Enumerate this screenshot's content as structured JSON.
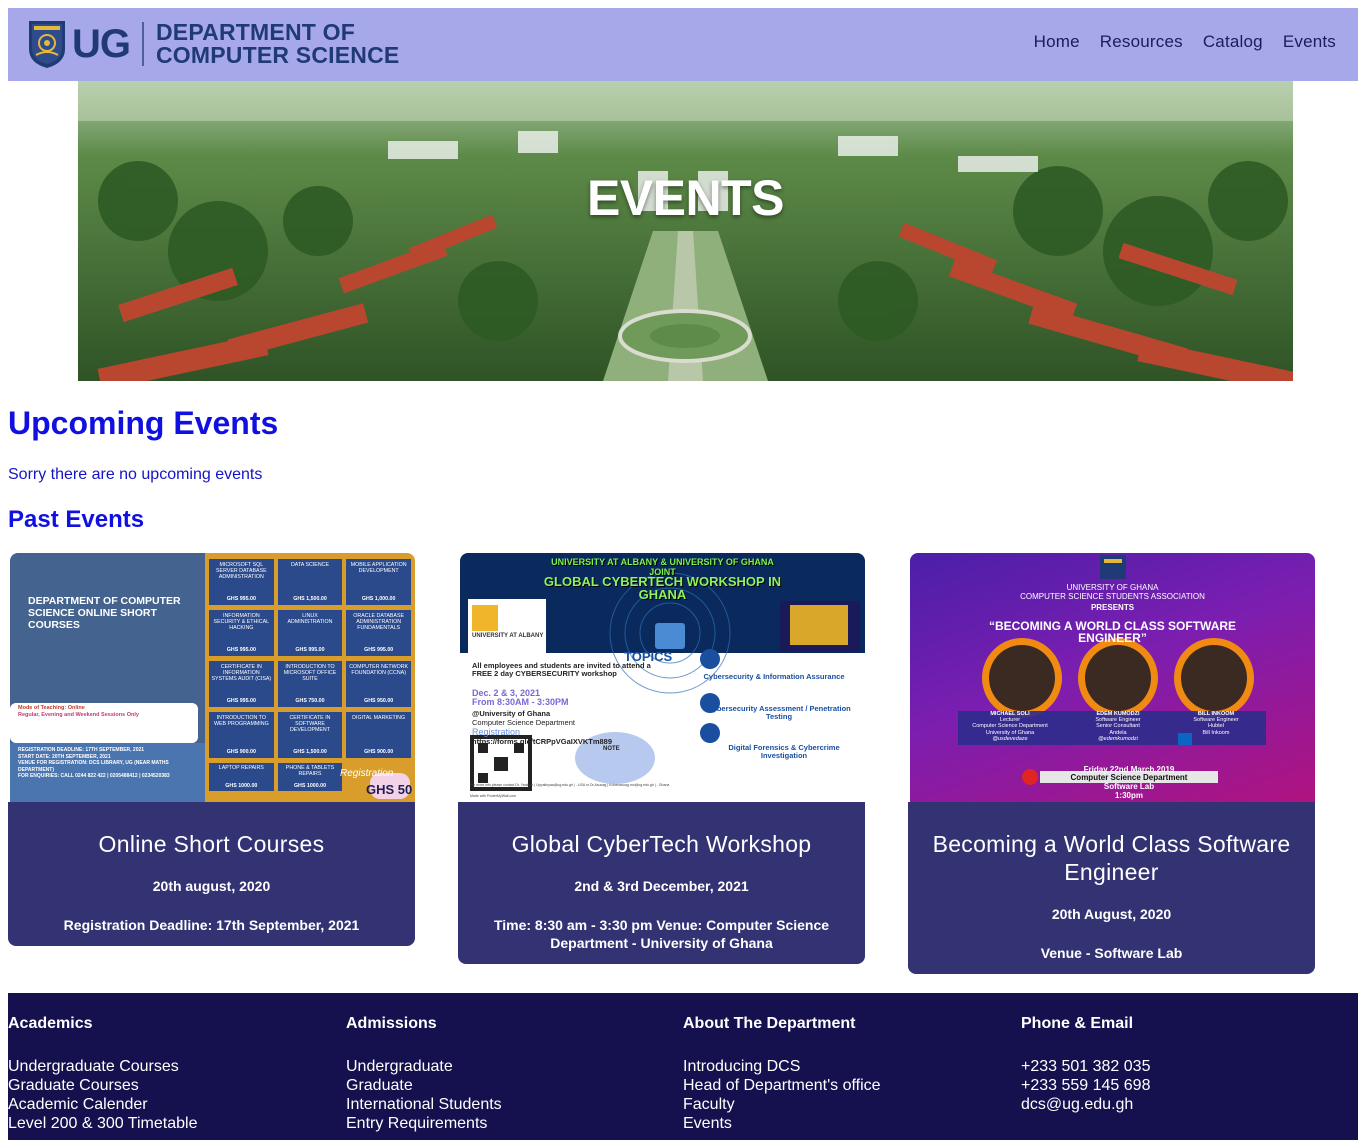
{
  "header": {
    "logo_text": "UG",
    "dept_line1": "DEPARTMENT OF",
    "dept_line2": "COMPUTER SCIENCE",
    "nav": [
      "Home",
      "Resources",
      "Catalog",
      "Events"
    ]
  },
  "hero": {
    "title": "EVENTS"
  },
  "upcoming": {
    "title": "Upcoming Events",
    "message": "Sorry there are no upcoming events"
  },
  "past": {
    "title": "Past Events",
    "events": [
      {
        "title": "Online Short Courses",
        "date": "20th august, 2020",
        "detail": "Registration Deadline: 17th September, 2021",
        "poster": {
          "heading": "DEPARTMENT OF COMPUTER SCIENCE ONLINE SHORT COURSES",
          "tiles": [
            [
              "MICROSOFT SQL SERVER DATABASE ADMINISTRATION",
              "GHS 995.00"
            ],
            [
              "DATA SCIENCE",
              "GHS 1,500.00"
            ],
            [
              "MOBILE APPLICATION DEVELOPMENT",
              "GHS 1,000.00"
            ],
            [
              "INFORMATION SECURITY & ETHICAL HACKING",
              "GHS 995.00"
            ],
            [
              "LINUX ADMINISTRATION",
              "GHS 995.00"
            ],
            [
              "ORACLE DATABASE ADMINISTRATION FUNDAMENTALS",
              "GHS 995.00"
            ],
            [
              "CERTIFICATE IN INFORMATION SYSTEMS AUDIT (CISA)",
              "GHS 995.00"
            ],
            [
              "INTRODUCTION TO MICROSOFT OFFICE SUITE",
              "GHS 750.00"
            ],
            [
              "COMPUTER NETWORK FOUNDATION (CCNA)",
              "GHS 950.00"
            ],
            [
              "INTRODUCTION TO WEB PROGRAMMING",
              "GHS 900.00"
            ],
            [
              "CERTIFICATE IN SOFTWARE DEVELOPMENT",
              "GHS 1,500.00"
            ],
            [
              "DIGITAL MARKETING",
              "GHS 900.00"
            ],
            [
              "LAPTOP REPAIRS",
              "GHS 1000.00"
            ],
            [
              "PHONE & TABLETS REPAIRS",
              "GHS 1000.00"
            ]
          ],
          "mode_label": "Mode of Teaching: Online",
          "sessions": "Regular, Evening and Weekend Sessions Only",
          "reg_deadline_label": "REGISTRATION DEADLINE:",
          "reg_deadline": "17TH SEPTEMBER, 2021",
          "start_label": "START DATE:",
          "start": "20TH SEPTEMBER, 2021",
          "venue": "VENUE FOR REGISTRATION: DCS LIBRARY, UG (NEAR MATHS DEPARTMENT)",
          "enquiries": "FOR ENQUIRIES: CALL 0244 822 422 | 0205488412 | 0234520383",
          "reg_fee": "GHS 50",
          "reg_script": "Registration"
        }
      },
      {
        "title": "Global CyberTech Workshop",
        "date": "2nd & 3rd December, 2021",
        "detail": "Time: 8:30 am - 3:30 pm Venue: Computer Science Department - University of Ghana",
        "poster": {
          "banner1": "UNIVERSITY AT ALBANY & UNIVERSITY OF GHANA",
          "banner2": "JOINT",
          "banner3": "GLOBAL CYBERTECH WORKSHOP IN GHANA",
          "albany": "UNIVERSITY AT ALBANY",
          "invite": "All employees and students are invited to attend a FREE 2 day CYBERSECURITY workshop",
          "dates": "Dec. 2 & 3, 2021",
          "time": "From 8:30AM - 3:30PM",
          "venue1": "@University of Ghana",
          "venue2": "Computer Science Department",
          "reg": "Registration",
          "link": "https://forms.gle/tCRPpVGaIXVKTm889",
          "topics": "TOPICS",
          "topic1": "Cybersecurity & Information Assurance",
          "topic2": "Cybersecurity Assessment / Penetration Testing",
          "topic3": "Digital Forensics & Cybercrime Investigation",
          "note": "NOTE",
          "contact": "For more info please contact Dr. Yaokum | Uppaltoyaa@ug.edu.gh | - USA or Dr.Asuoag | Kobenasuag.mu@ug.edu.gh | - Ghana",
          "made_with": "Made with PosterMyWall.com"
        }
      },
      {
        "title": "Becoming a World Class Software Engineer",
        "date": "20th August, 2020",
        "detail": "Venue - Software Lab",
        "poster": {
          "org1": "UNIVERSITY OF GHANA",
          "org2": "COMPUTER SCIENCE STUDENTS ASSOCIATION",
          "presents": "PRESENTS",
          "headline": "“BECOMING A WORLD CLASS SOFTWARE ENGINEER”",
          "speakers": [
            {
              "name": "MICHAEL SOLI",
              "role": "Lecturer",
              "org": "Computer Science Department",
              "org2": "University of Ghana",
              "handle": "@usdevedaze"
            },
            {
              "name": "EDEM KUMODZI",
              "role": "Software Engineer",
              "org": "Senior Consultant",
              "org2": "Andela",
              "handle": "@edemkumodzi"
            },
            {
              "name": "BILL INKOOM",
              "role": "Software Engineer",
              "org": "Hubtel",
              "org2": "",
              "handle": "Bill Inkoom"
            }
          ],
          "date": "Friday 22nd March,2019",
          "venue1": "Computer Science Department",
          "venue2": "Software Lab",
          "time": "1:30pm"
        }
      }
    ]
  },
  "footer": {
    "columns": [
      {
        "title": "Academics",
        "links": [
          "Undergraduate Courses",
          "Graduate Courses",
          "Academic Calender",
          "Level 200 & 300 Timetable"
        ]
      },
      {
        "title": "Admissions",
        "links": [
          "Undergraduate",
          "Graduate",
          "International Students",
          "Entry Requirements"
        ]
      },
      {
        "title": "About The Department",
        "links": [
          "Introducing DCS",
          "Head of Department's office",
          "Faculty",
          "Events"
        ]
      },
      {
        "title": "Phone & Email",
        "links": [
          "+233 501 382 035",
          "+233 559 145 698",
          "dcs@ug.edu.gh"
        ]
      }
    ]
  },
  "colors": {
    "header_bg": "#a7a8ea",
    "brand_navy": "#1f3a75",
    "heading_blue": "#1010e0",
    "card_bg": "#333374",
    "footer_bg": "#14114e"
  }
}
